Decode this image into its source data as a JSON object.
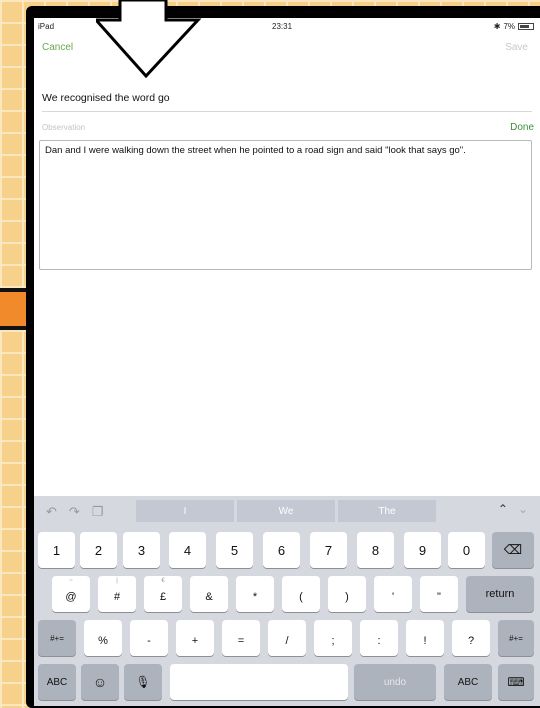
{
  "status": {
    "device": "iPad",
    "time": "23:31",
    "battery": "7%"
  },
  "nav": {
    "cancel": "Cancel",
    "save": "Save"
  },
  "form": {
    "title": "We recognised the word go",
    "obs_label": "Observation",
    "done": "Done",
    "observation_text": "Dan and I were walking down the street when he pointed to a road sign and said \"look that says go\"."
  },
  "suggestions": [
    "I",
    "We",
    "The"
  ],
  "keyboard": {
    "row1": [
      "1",
      "2",
      "3",
      "4",
      "5",
      "6",
      "7",
      "8",
      "9",
      "0"
    ],
    "row2": [
      {
        "top": "~",
        "main": "@"
      },
      {
        "top": "|",
        "main": "#"
      },
      {
        "top": "€",
        "main": "£"
      },
      {
        "top": "",
        "main": "&"
      },
      {
        "top": "",
        "main": "*"
      },
      {
        "top": "",
        "main": "("
      },
      {
        "top": "",
        "main": ")"
      },
      {
        "top": "",
        "main": "'"
      },
      {
        "top": "",
        "main": "\""
      }
    ],
    "row3": [
      {
        "top": "",
        "main": "%"
      },
      {
        "top": "",
        "main": "-"
      },
      {
        "top": "",
        "main": "+"
      },
      {
        "top": "",
        "main": "="
      },
      {
        "top": "",
        "main": "/"
      },
      {
        "top": "",
        "main": ";"
      },
      {
        "top": "",
        "main": ":"
      },
      {
        "top": "",
        "main": "!"
      },
      {
        "top": "",
        "main": "?"
      }
    ],
    "shift_label": "#+=",
    "return_label": "return",
    "abc_label": "ABC",
    "undo_label": "undo",
    "emoji": "☺",
    "mic": "🎤"
  },
  "colors": {
    "accent": "#6aa84f",
    "done": "#3f8f3a"
  }
}
